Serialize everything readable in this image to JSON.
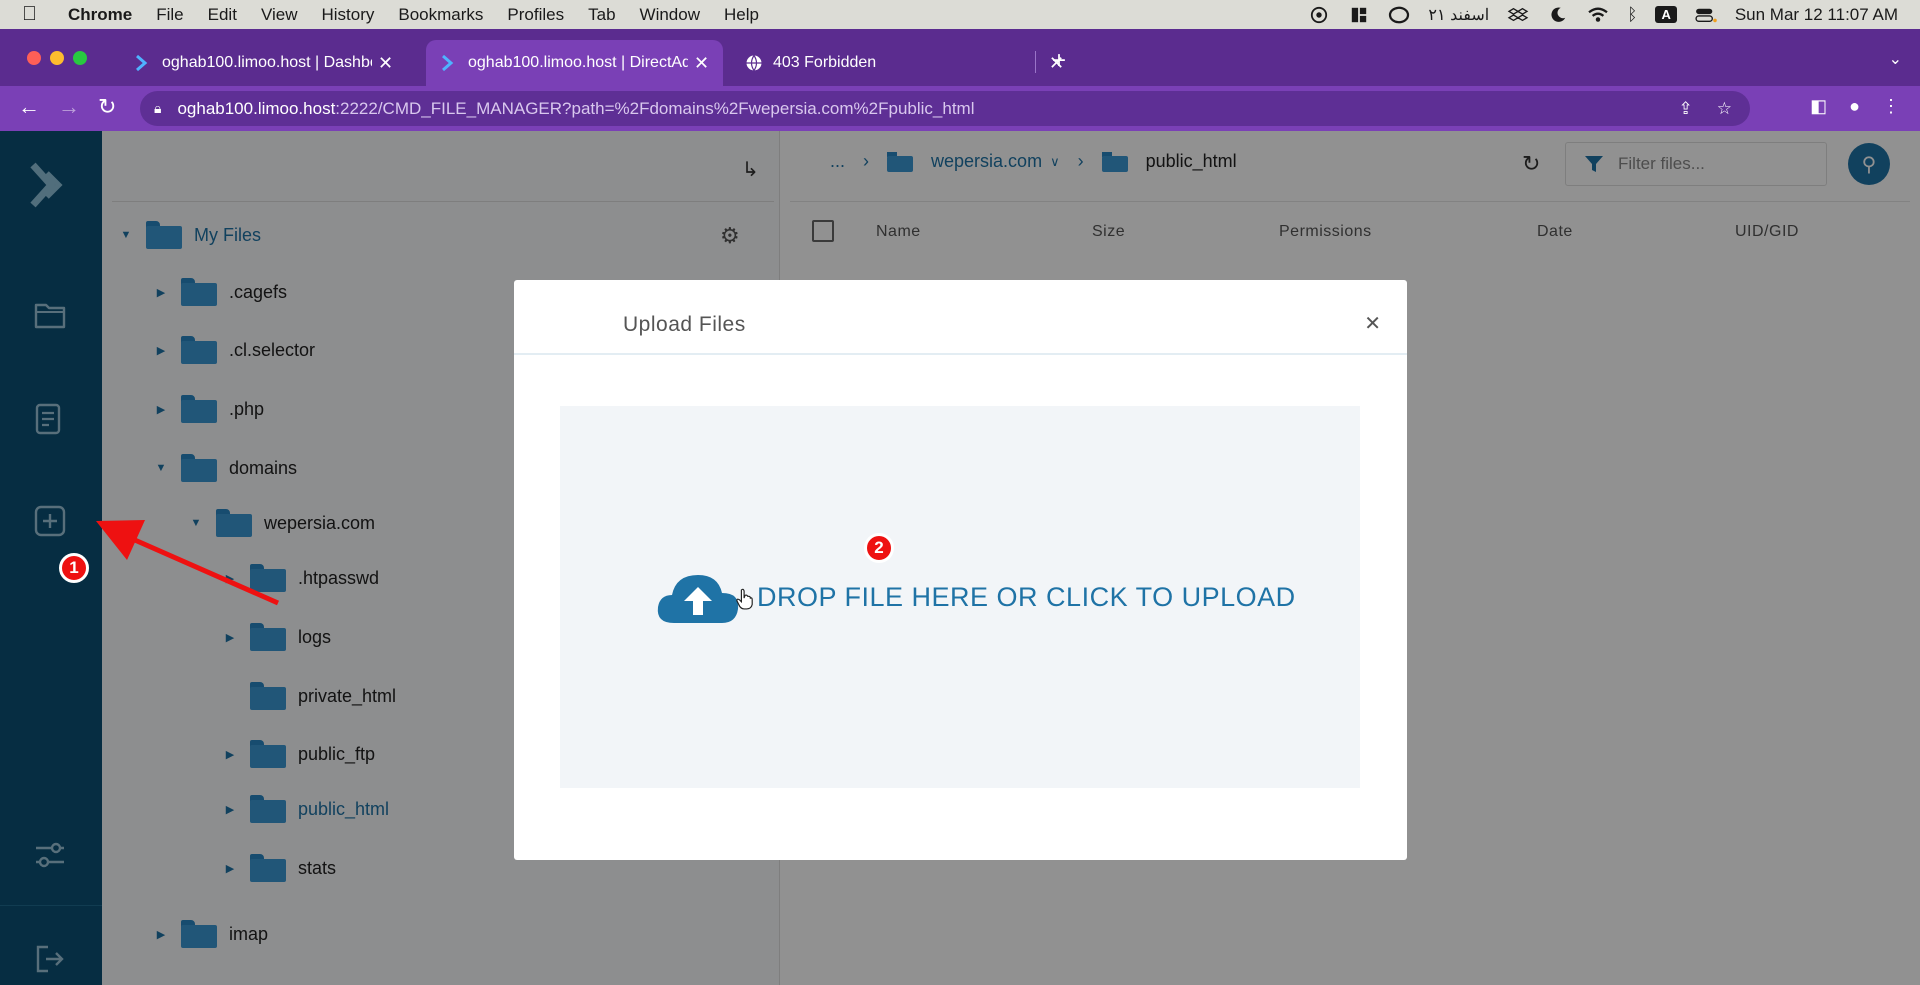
{
  "menubar": {
    "app": "Chrome",
    "items": [
      "File",
      "Edit",
      "View",
      "History",
      "Bookmarks",
      "Profiles",
      "Tab",
      "Window",
      "Help"
    ],
    "persian_date": "۲۱ اسفند",
    "input_source": "A",
    "clock": "Sun Mar 12  11:07 AM"
  },
  "tabs": [
    {
      "title": "oghab100.limoo.host | Dashboard"
    },
    {
      "title": "oghab100.limoo.host | DirectAdmin"
    },
    {
      "title": "403 Forbidden"
    }
  ],
  "address": {
    "host": "oghab100.limoo.host",
    "rest": ":2222/CMD_FILE_MANAGER?path=%2Fdomains%2Fwepersia.com%2Fpublic_html"
  },
  "tree": {
    "root": "My Files",
    "items": [
      {
        "label": ".cagefs"
      },
      {
        "label": ".cl.selector"
      },
      {
        "label": ".php"
      },
      {
        "label": "domains"
      },
      {
        "label": "wepersia.com"
      },
      {
        "label": ".htpasswd"
      },
      {
        "label": "logs"
      },
      {
        "label": "private_html"
      },
      {
        "label": "public_ftp"
      },
      {
        "label": "public_html"
      },
      {
        "label": "stats"
      },
      {
        "label": "imap"
      }
    ]
  },
  "main": {
    "crumb_more": "...",
    "crumb_domain": "wepersia.com",
    "crumb_current": "public_html",
    "filter_placeholder": "Filter files...",
    "columns": [
      "Name",
      "Size",
      "Permissions",
      "Date",
      "UID/GID"
    ]
  },
  "modal": {
    "title": "Upload Files",
    "drop_text": "DROP FILE HERE OR CLICK TO UPLOAD"
  },
  "annotations": {
    "step1": "1",
    "step2": "2"
  },
  "colors": {
    "accent": "#1f73a6",
    "sidebar": "#0b4f74",
    "browser": "#7a40b6",
    "marker": "#e11111"
  }
}
